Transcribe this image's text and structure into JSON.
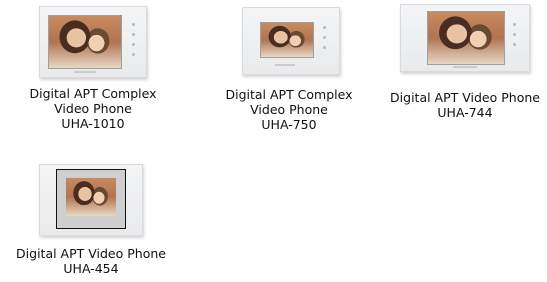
{
  "products": [
    {
      "name_line1": "Digital APT Complex",
      "name_line2": "Video Phone",
      "model": "UHA-1010",
      "icon": "video-phone-image"
    },
    {
      "name_line1": "Digital APT Complex",
      "name_line2": "Video Phone",
      "model": "UHA-750",
      "icon": "video-phone-image"
    },
    {
      "name_line1": "Digital APT Video Phone",
      "model": "UHA-744",
      "icon": "video-phone-image"
    },
    {
      "name_line1": "Digital APT Video Phone",
      "model": "UHA-454",
      "icon": "video-phone-image"
    }
  ]
}
